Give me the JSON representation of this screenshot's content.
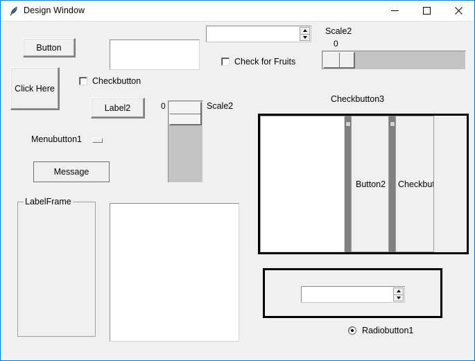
{
  "window": {
    "title": "Design Window",
    "icon": "feather-icon",
    "accent": "#0078d7",
    "background": "#f0f0f0",
    "controls": {
      "minimize": "minimize-icon",
      "maximize": "maximize-icon",
      "close": "close-icon"
    }
  },
  "widgets": {
    "button1": {
      "label": "Button"
    },
    "click_here": {
      "label": "Click Here"
    },
    "entry1": {
      "value": "",
      "placeholder": ""
    },
    "spinbox_top": {
      "value": "",
      "placeholder": ""
    },
    "check_fruits": {
      "label": "Check for Fruits",
      "checked": false
    },
    "scale_horizontal": {
      "label": "Scale2",
      "value": "0"
    },
    "checkbutton1": {
      "label": "Checkbutton",
      "checked": false
    },
    "label2": {
      "label": "Label2"
    },
    "scale_vertical": {
      "label": "Scale2",
      "value": "0"
    },
    "menubutton1": {
      "label": "Menubutton1"
    },
    "message1": {
      "label": "Message"
    },
    "labelframe": {
      "title": "LabelFrame"
    },
    "textarea": {
      "value": ""
    },
    "checkbutton3": {
      "label": "Checkbutton3"
    },
    "panedwindow": {
      "panes": [
        {
          "name": "listbox-pane",
          "label": ""
        },
        {
          "name": "button2-pane",
          "label": "Button2"
        },
        {
          "name": "checkbutton-pane",
          "label": "Checkbut"
        },
        {
          "name": "empty-pane",
          "label": ""
        }
      ]
    },
    "spinbox_bottom": {
      "value": "",
      "placeholder": ""
    },
    "radiobutton1": {
      "label": "Radiobutton1",
      "selected": true
    }
  }
}
